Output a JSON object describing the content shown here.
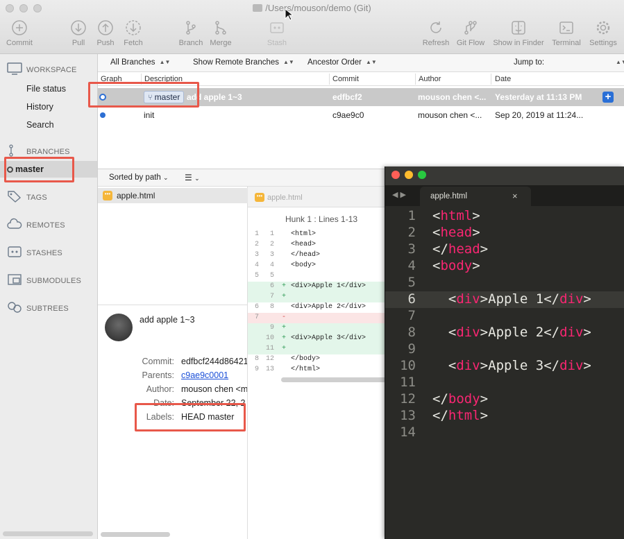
{
  "window": {
    "title": "/Users/mouson/demo (Git)"
  },
  "toolbar": {
    "commit": "Commit",
    "pull": "Pull",
    "push": "Push",
    "fetch": "Fetch",
    "branch": "Branch",
    "merge": "Merge",
    "stash": "Stash",
    "refresh": "Refresh",
    "gitflow": "Git Flow",
    "finder": "Show in Finder",
    "terminal": "Terminal",
    "settings": "Settings"
  },
  "sidebar": {
    "workspace": "WORKSPACE",
    "file_status": "File status",
    "history": "History",
    "search": "Search",
    "branches": "BRANCHES",
    "master": "master",
    "tags": "TAGS",
    "remotes": "REMOTES",
    "stashes": "STASHES",
    "submodules": "SUBMODULES",
    "subtrees": "SUBTREES"
  },
  "filters": {
    "branches": "All Branches",
    "remote": "Show Remote Branches",
    "order": "Ancestor Order",
    "jump": "Jump to:"
  },
  "table": {
    "headers": {
      "graph": "Graph",
      "description": "Description",
      "commit": "Commit",
      "author": "Author",
      "date": "Date"
    },
    "rows": [
      {
        "tag": "master",
        "description": "add apple 1~3",
        "commit": "edfbcf2",
        "author": "mouson chen <...",
        "date": "Yesterday at 11:13 PM"
      },
      {
        "tag": "",
        "description": "init",
        "commit": "c9ae9c0",
        "author": "mouson chen <...",
        "date": "Sep 20, 2019 at 11:24..."
      }
    ]
  },
  "files": {
    "sort": "Sorted by path",
    "list": [
      {
        "name": "apple.html"
      }
    ]
  },
  "details": {
    "message": "add apple 1~3",
    "commit_label": "Commit:",
    "commit": "edfbcf244d86421",
    "parents_label": "Parents:",
    "parents": "c9ae9c0001",
    "author_label": "Author:",
    "author": "mouson chen <m",
    "date_label": "Date:",
    "date": "September 22, 2",
    "labels_label": "Labels:",
    "labels": "HEAD master"
  },
  "diff": {
    "file": "apple.html",
    "hunk": "Hunk 1 : Lines 1-13",
    "lines": [
      {
        "old": "1",
        "new": "1",
        "sign": "",
        "type": "ctx",
        "code": "<html>"
      },
      {
        "old": "2",
        "new": "2",
        "sign": "",
        "type": "ctx",
        "code": "<head>"
      },
      {
        "old": "3",
        "new": "3",
        "sign": "",
        "type": "ctx",
        "code": "</head>"
      },
      {
        "old": "4",
        "new": "4",
        "sign": "",
        "type": "ctx",
        "code": "<body>"
      },
      {
        "old": "5",
        "new": "5",
        "sign": "",
        "type": "ctx",
        "code": ""
      },
      {
        "old": "",
        "new": "6",
        "sign": "+",
        "type": "add",
        "code": "  <div>Apple 1</div>"
      },
      {
        "old": "",
        "new": "7",
        "sign": "+",
        "type": "add",
        "code": ""
      },
      {
        "old": "6",
        "new": "8",
        "sign": "",
        "type": "ctx",
        "code": "  <div>Apple 2</div>"
      },
      {
        "old": "7",
        "new": "",
        "sign": "-",
        "type": "del",
        "code": ""
      },
      {
        "old": "",
        "new": "9",
        "sign": "+",
        "type": "add",
        "code": ""
      },
      {
        "old": "",
        "new": "10",
        "sign": "+",
        "type": "add",
        "code": "  <div>Apple 3</div>"
      },
      {
        "old": "",
        "new": "11",
        "sign": "+",
        "type": "add",
        "code": ""
      },
      {
        "old": "8",
        "new": "12",
        "sign": "",
        "type": "ctx",
        "code": "</body>"
      },
      {
        "old": "9",
        "new": "13",
        "sign": "",
        "type": "ctx",
        "code": "</html>"
      }
    ]
  },
  "editor": {
    "tab": "apple.html",
    "current_line": 6,
    "lines": [
      {
        "no": "1",
        "indent": "",
        "tag": "html",
        "close": false,
        "content": ""
      },
      {
        "no": "2",
        "indent": "",
        "tag": "head",
        "close": false,
        "content": ""
      },
      {
        "no": "3",
        "indent": "",
        "tag": "head",
        "close": true,
        "content": ""
      },
      {
        "no": "4",
        "indent": "",
        "tag": "body",
        "close": false,
        "content": ""
      },
      {
        "no": "5",
        "indent": "",
        "tag": "",
        "close": false,
        "content": ""
      },
      {
        "no": "6",
        "indent": "  ",
        "tag": "div",
        "close": false,
        "content": "Apple 1"
      },
      {
        "no": "7",
        "indent": "",
        "tag": "",
        "close": false,
        "content": ""
      },
      {
        "no": "8",
        "indent": "  ",
        "tag": "div",
        "close": false,
        "content": "Apple 2"
      },
      {
        "no": "9",
        "indent": "",
        "tag": "",
        "close": false,
        "content": ""
      },
      {
        "no": "10",
        "indent": "  ",
        "tag": "div",
        "close": false,
        "content": "Apple 3"
      },
      {
        "no": "11",
        "indent": "",
        "tag": "",
        "close": false,
        "content": ""
      },
      {
        "no": "12",
        "indent": "",
        "tag": "body",
        "close": true,
        "content": ""
      },
      {
        "no": "13",
        "indent": "",
        "tag": "html",
        "close": true,
        "content": ""
      },
      {
        "no": "14",
        "indent": "",
        "tag": "",
        "close": false,
        "content": ""
      }
    ]
  },
  "colors": {
    "highlight": "#e8584a",
    "accent": "#2a6fd6",
    "tag": "#f92672",
    "add_bg": "#e3f6ea",
    "del_bg": "#fbe5e5"
  }
}
